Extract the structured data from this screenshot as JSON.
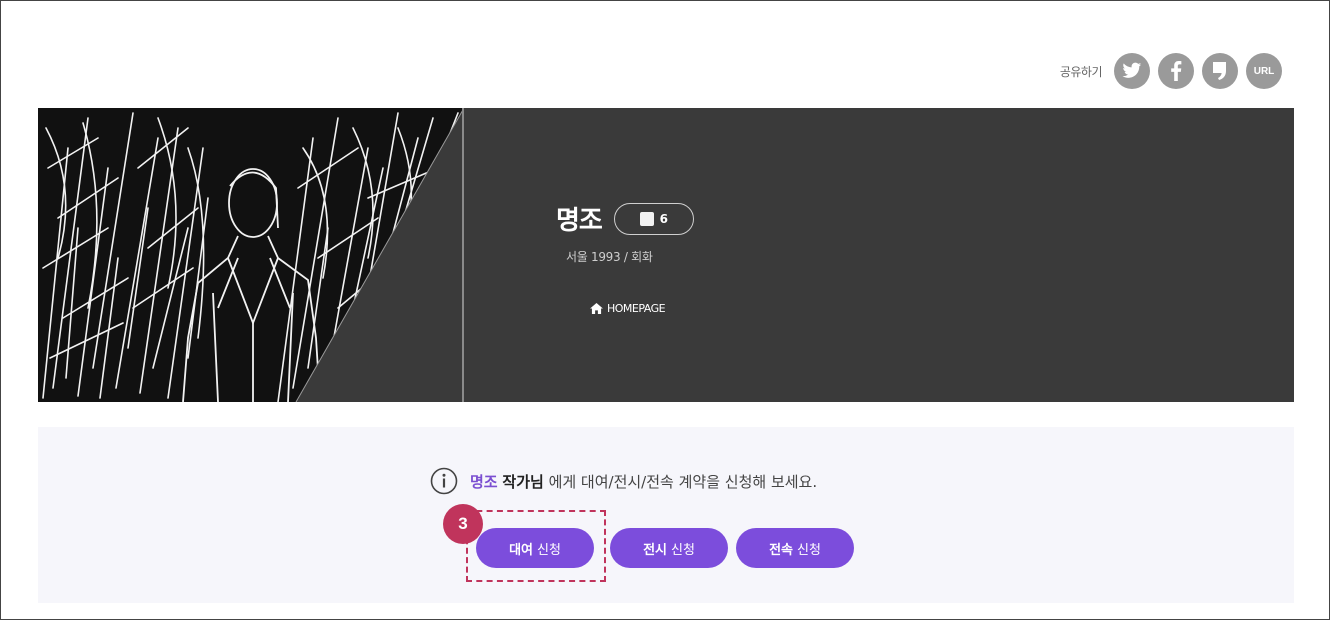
{
  "share": {
    "label": "공유하기",
    "buttons": [
      {
        "name": "twitter",
        "icon": "twitter-icon"
      },
      {
        "name": "facebook",
        "icon": "facebook-icon"
      },
      {
        "name": "blog",
        "icon": "blog-icon"
      },
      {
        "name": "url",
        "icon": "link-icon",
        "text": "URL"
      }
    ]
  },
  "artist": {
    "name": "명조",
    "work_count": "6",
    "meta": "서울 1993 / 회화",
    "homepage_label": "HOMEPAGE"
  },
  "contract": {
    "artist_name": "명조",
    "title_suffix": "작가님",
    "message": " 에게 대여/전시/전속 계약을 신청해 보세요.",
    "buttons": [
      {
        "bold": "대여",
        "rest": "신청"
      },
      {
        "bold": "전시",
        "rest": "신청"
      },
      {
        "bold": "전속",
        "rest": "신청"
      }
    ]
  },
  "annotation": {
    "step": "3"
  },
  "colors": {
    "accent": "#7c4ddc",
    "hero_bg": "#3a3a3a",
    "annotation": "#c0345c",
    "share_icon": "#9a9a9a"
  }
}
